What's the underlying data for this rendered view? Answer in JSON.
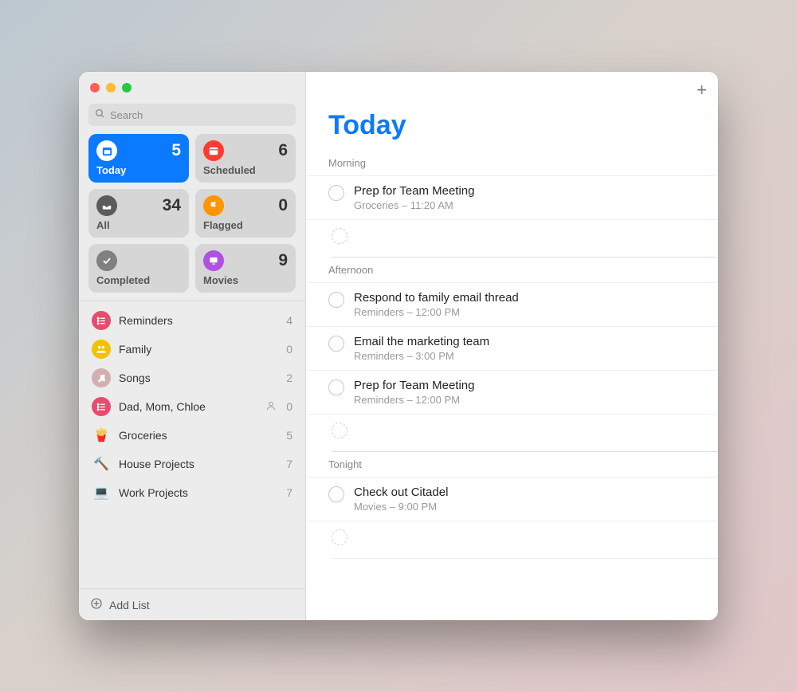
{
  "search": {
    "placeholder": "Search"
  },
  "cards": [
    {
      "id": "today",
      "label": "Today",
      "count": "5",
      "icon": "calendar-today-icon",
      "bg": "#fff",
      "fg": "#0a7aff",
      "active": true
    },
    {
      "id": "scheduled",
      "label": "Scheduled",
      "count": "6",
      "icon": "calendar-icon",
      "bg": "#ff3b30",
      "fg": "#fff"
    },
    {
      "id": "all",
      "label": "All",
      "count": "34",
      "icon": "tray-icon",
      "bg": "#5b5b5b",
      "fg": "#fff"
    },
    {
      "id": "flagged",
      "label": "Flagged",
      "count": "0",
      "icon": "flag-icon",
      "bg": "#ff9500",
      "fg": "#fff"
    },
    {
      "id": "completed",
      "label": "Completed",
      "count": "",
      "icon": "check-icon",
      "bg": "#808080",
      "fg": "#fff"
    },
    {
      "id": "movies",
      "label": "Movies",
      "count": "9",
      "icon": "display-icon",
      "bg": "#af52de",
      "fg": "#fff"
    }
  ],
  "lists": [
    {
      "name": "Reminders",
      "count": "4",
      "icon": "list-icon",
      "bg": "#e84c6c"
    },
    {
      "name": "Family",
      "count": "0",
      "icon": "people-icon",
      "bg": "#f2c200"
    },
    {
      "name": "Songs",
      "count": "2",
      "icon": "music-icon",
      "bg": "#d1b0ae"
    },
    {
      "name": "Dad, Mom, Chloe",
      "count": "0",
      "icon": "list-icon",
      "bg": "#e84c6c",
      "shared": true
    },
    {
      "name": "Groceries",
      "count": "5",
      "icon": "fries-icon",
      "plain": true
    },
    {
      "name": "House Projects",
      "count": "7",
      "icon": "hammer-icon",
      "plain": true
    },
    {
      "name": "Work Projects",
      "count": "7",
      "icon": "laptop-icon",
      "plain": true
    }
  ],
  "addlist_label": "Add List",
  "main": {
    "title": "Today",
    "sections": [
      {
        "header": "Morning",
        "tasks": [
          {
            "title": "Prep for Team Meeting",
            "sub": "Groceries – 11:20 AM"
          }
        ],
        "ghost": true
      },
      {
        "header": "Afternoon",
        "tasks": [
          {
            "title": "Respond to family email thread",
            "sub": "Reminders – 12:00 PM"
          },
          {
            "title": "Email the marketing team",
            "sub": "Reminders – 3:00 PM"
          },
          {
            "title": "Prep for Team Meeting",
            "sub": "Reminders – 12:00 PM"
          }
        ],
        "ghost": true
      },
      {
        "header": "Tonight",
        "tasks": [
          {
            "title": "Check out Citadel",
            "sub": "Movies – 9:00 PM"
          }
        ],
        "ghost": true
      }
    ]
  }
}
